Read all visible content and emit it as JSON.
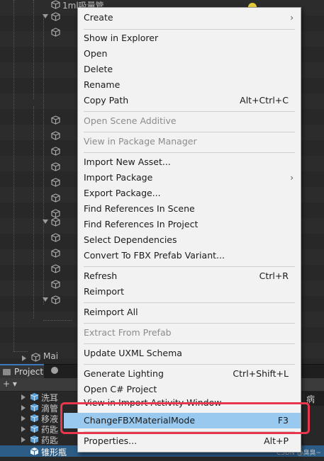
{
  "hierarchy": {
    "top_item": "1ml吸量管",
    "main_item": "Mai"
  },
  "project_panel": {
    "tab_label": "Project",
    "add_label": "+ ▾",
    "items": [
      "洗耳",
      "滴管",
      "移液",
      "药匙",
      "药匙",
      "锥形瓶"
    ],
    "selected_index": 5,
    "right_tab_label": "病"
  },
  "context_menu": {
    "items": [
      {
        "label": "Create",
        "submenu": true
      },
      {
        "label": "Show in Explorer"
      },
      {
        "label": "Open"
      },
      {
        "label": "Delete"
      },
      {
        "label": "Rename"
      },
      {
        "label": "Copy Path",
        "shortcut": "Alt+Ctrl+C"
      },
      {
        "label": "Open Scene Additive",
        "disabled": true
      },
      {
        "label": "View in Package Manager",
        "disabled": true
      },
      {
        "label": "Import New Asset..."
      },
      {
        "label": "Import Package",
        "submenu": true
      },
      {
        "label": "Export Package..."
      },
      {
        "label": "Find References In Scene"
      },
      {
        "label": "Find References In Project"
      },
      {
        "label": "Select Dependencies"
      },
      {
        "label": "Convert To FBX Prefab Variant..."
      },
      {
        "label": "Refresh",
        "shortcut": "Ctrl+R"
      },
      {
        "label": "Reimport"
      },
      {
        "label": "Reimport All"
      },
      {
        "label": "Extract From Prefab",
        "disabled": true
      },
      {
        "label": "Update UXML Schema"
      },
      {
        "label": "Generate Lighting",
        "shortcut": "Ctrl+Shift+L"
      },
      {
        "label": "Open C# Project"
      },
      {
        "label": "View in Import Activity Window"
      },
      {
        "label": "ChangeFBXMaterialMode",
        "shortcut": "F3",
        "highlighted": true
      },
      {
        "label": "Properties...",
        "shortcut": "Alt+P"
      }
    ],
    "submenu_arrow": "›"
  },
  "watermark": "CSDN @臭臭~",
  "colors": {
    "menu_bg": "#f2f2f2",
    "highlight": "#99c9ef",
    "annotation_box": "#e8374c",
    "selection": "#2c5d87"
  }
}
